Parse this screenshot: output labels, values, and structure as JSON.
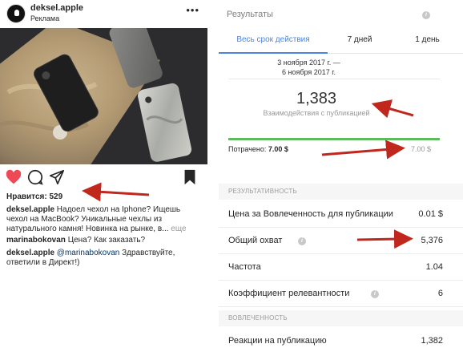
{
  "post": {
    "username": "deksel.apple",
    "sponsored_label": "Реклама",
    "likes": "Нравится: 529",
    "caption_user": "deksel.apple",
    "caption_text": " Надоел чехол на Iphone? Ищешь чехол на MacBook? Уникальные чехлы из натурального камня! Новинка на рынке, в...",
    "caption_more": " еще",
    "comments": [
      {
        "user": "marinabokovan",
        "text": " Цена? Как заказать?"
      },
      {
        "user": "deksel.apple",
        "mention": " @marinabokovan",
        "text": " Здравствуйте, ответили в Директ!)"
      }
    ],
    "icons": [
      "heart-icon",
      "comment-icon",
      "share-icon",
      "bookmark-icon",
      "more-icon"
    ]
  },
  "results": {
    "title": "Результаты",
    "tabs": [
      "Весь срок действия",
      "7 дней",
      "1 день"
    ],
    "active_tab": 0,
    "date_line1": "3 ноября 2017 г. —",
    "date_line2": "6 ноября 2017 г.",
    "interactions_value": "1,383",
    "interactions_label": "Взаимодействия с публикацией",
    "spent_label": "Потрачено:",
    "spent_value": "7.00 $",
    "spent_max": "7.00 $",
    "spent_fraction": 1.0,
    "performance_header": "РЕЗУЛЬТАТИВНОСТЬ",
    "metrics": [
      {
        "label": "Цена за Вовлеченность для публикации",
        "value": "0.01 $"
      },
      {
        "label": "Общий охват",
        "value": "5,376"
      },
      {
        "label": "Частота",
        "value": "1.04"
      },
      {
        "label": "Коэффициент релевантности",
        "value": "6"
      }
    ],
    "engagement_header": "ВОВЛЕЧЕННОСТЬ",
    "engagement_rows": [
      {
        "label": "Реакции на публикацию",
        "value": "1,382"
      }
    ]
  },
  "colors": {
    "accent_blue": "#4a84e6",
    "progress_green": "#5fba5f",
    "like_red": "#ed4956",
    "annotation_red": "#c0281e"
  }
}
